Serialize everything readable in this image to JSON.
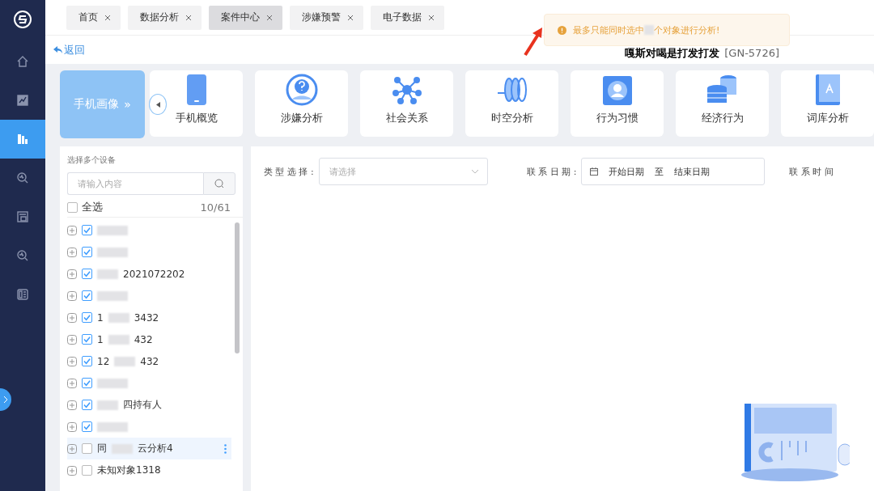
{
  "sidebar": {
    "items": [
      {
        "selected": false
      },
      {
        "selected": false
      },
      {
        "selected": true
      },
      {
        "selected": false
      },
      {
        "selected": false
      },
      {
        "selected": false
      },
      {
        "selected": false
      }
    ]
  },
  "tabs": [
    {
      "label": "首页",
      "selected": false
    },
    {
      "label": "数据分析",
      "selected": false
    },
    {
      "label": "案件中心",
      "selected": true
    },
    {
      "label": "涉嫌预警",
      "selected": false
    },
    {
      "label": "电子数据",
      "selected": false
    }
  ],
  "toast": {
    "text_before": "最多只能同时选中",
    "text_after": "个对象进行分析!"
  },
  "back_link": "返回",
  "case_title": "嘎斯对喝是打发打发",
  "case_code": "[GN-5726]",
  "profile_card": {
    "label": "手机画像",
    "chevron": "»"
  },
  "modules": [
    {
      "label": "手机概览"
    },
    {
      "label": "涉嫌分析"
    },
    {
      "label": "社会关系"
    },
    {
      "label": "时空分析"
    },
    {
      "label": "行为习惯"
    },
    {
      "label": "经济行为"
    },
    {
      "label": "词库分析"
    }
  ],
  "device_panel": {
    "title": "选择多个设备",
    "search_placeholder": "请输入内容",
    "select_all": {
      "label": "全选",
      "checked": false
    },
    "count": "10/61",
    "items": [
      {
        "checked": true,
        "selected": false
      },
      {
        "checked": true,
        "selected": false
      },
      {
        "checked": true,
        "selected": false,
        "suffix": "2021072202"
      },
      {
        "checked": true,
        "selected": false
      },
      {
        "checked": true,
        "selected": false,
        "prefix": "1",
        "suffix": "3432"
      },
      {
        "checked": true,
        "selected": false,
        "prefix": "1",
        "suffix": "432"
      },
      {
        "checked": true,
        "selected": false,
        "prefix": "12",
        "suffix": "432"
      },
      {
        "checked": true,
        "selected": false
      },
      {
        "checked": true,
        "selected": false,
        "suffix": "四持有人"
      },
      {
        "checked": true,
        "selected": false
      },
      {
        "checked": false,
        "selected": true,
        "prefix": "同",
        "suffix": "云分析4"
      },
      {
        "checked": false,
        "selected": false,
        "prefix": "未知对象1318"
      }
    ]
  },
  "filters": {
    "type_label": "类 型 选 择 :",
    "type_placeholder": "请选择",
    "date_label": "联 系 日 期 :",
    "start_placeholder": "开始日期",
    "date_separator": "至",
    "end_placeholder": "结束日期",
    "time_label": "联 系 时 间"
  }
}
